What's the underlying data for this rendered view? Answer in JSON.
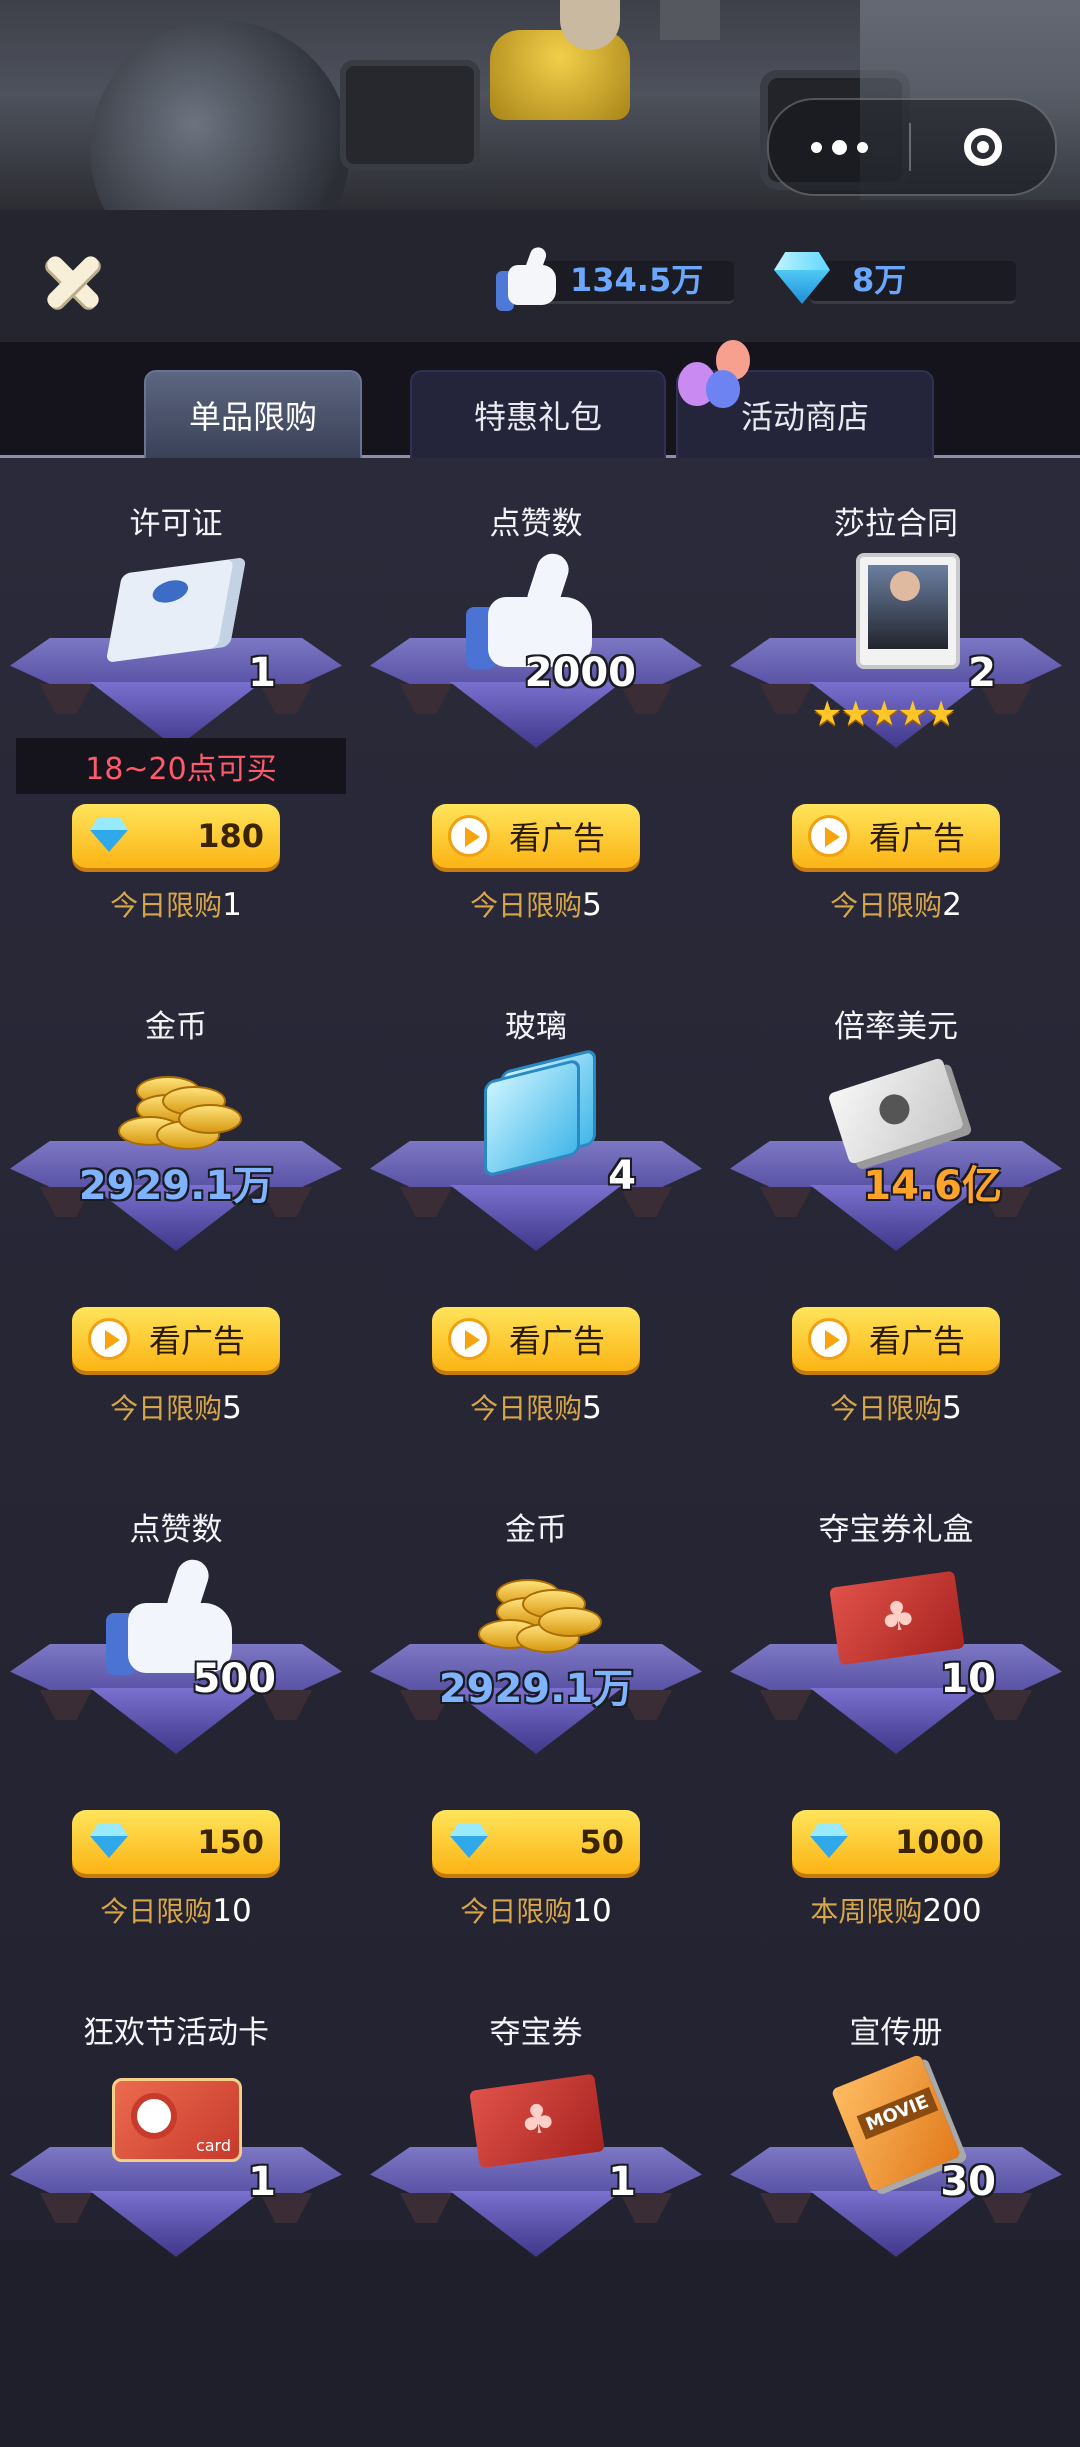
{
  "header": {
    "likes_value": "134.5万",
    "gems_value": "8万",
    "accent_color": "#6aa8ff"
  },
  "tabs": [
    {
      "label": "单品限购",
      "active": true
    },
    {
      "label": "特惠礼包",
      "active": false
    },
    {
      "label": "活动商店",
      "active": false
    }
  ],
  "items": [
    {
      "name": "许可证",
      "icon": "license-scroll-icon",
      "count": "1",
      "notice": "18~20点可买",
      "price": "180",
      "buy_type": "gem",
      "limit_label": "今日限购",
      "limit_value": "1"
    },
    {
      "name": "点赞数",
      "icon": "thumbs-up-icon",
      "count": "2000",
      "buy_type": "ad",
      "ad_label": "看广告",
      "limit_label": "今日限购",
      "limit_value": "5"
    },
    {
      "name": "莎拉合同",
      "icon": "character-card-icon",
      "count": "2",
      "stars": "★★★★★",
      "buy_type": "ad",
      "ad_label": "看广告",
      "limit_label": "今日限购",
      "limit_value": "2"
    },
    {
      "name": "金币",
      "icon": "gold-coins-icon",
      "count": "2929.1万",
      "buy_type": "ad",
      "ad_label": "看广告",
      "limit_label": "今日限购",
      "limit_value": "5"
    },
    {
      "name": "玻璃",
      "icon": "glass-panes-icon",
      "count": "4",
      "buy_type": "ad",
      "ad_label": "看广告",
      "limit_label": "今日限购",
      "limit_value": "5"
    },
    {
      "name": "倍率美元",
      "icon": "dollar-bill-icon",
      "count": "14.6亿",
      "buy_type": "ad",
      "ad_label": "看广告",
      "limit_label": "今日限购",
      "limit_value": "5"
    },
    {
      "name": "点赞数",
      "icon": "thumbs-up-icon",
      "count": "500",
      "price": "150",
      "buy_type": "gem",
      "limit_label": "今日限购",
      "limit_value": "10"
    },
    {
      "name": "金币",
      "icon": "gold-coins-icon",
      "count": "2929.1万",
      "price": "50",
      "buy_type": "gem",
      "limit_label": "今日限购",
      "limit_value": "10"
    },
    {
      "name": "夺宝券礼盒",
      "icon": "lottery-ticket-box-icon",
      "count": "10",
      "price": "1000",
      "buy_type": "gem",
      "limit_label": "本周限购",
      "limit_value": "200"
    },
    {
      "name": "狂欢节活动卡",
      "icon": "carnival-card-icon",
      "count": "1",
      "card_text": "card"
    },
    {
      "name": "夺宝券",
      "icon": "lottery-ticket-icon",
      "count": "1"
    },
    {
      "name": "宣传册",
      "icon": "brochure-icon",
      "count": "30",
      "book_text": "MOVIE"
    }
  ]
}
